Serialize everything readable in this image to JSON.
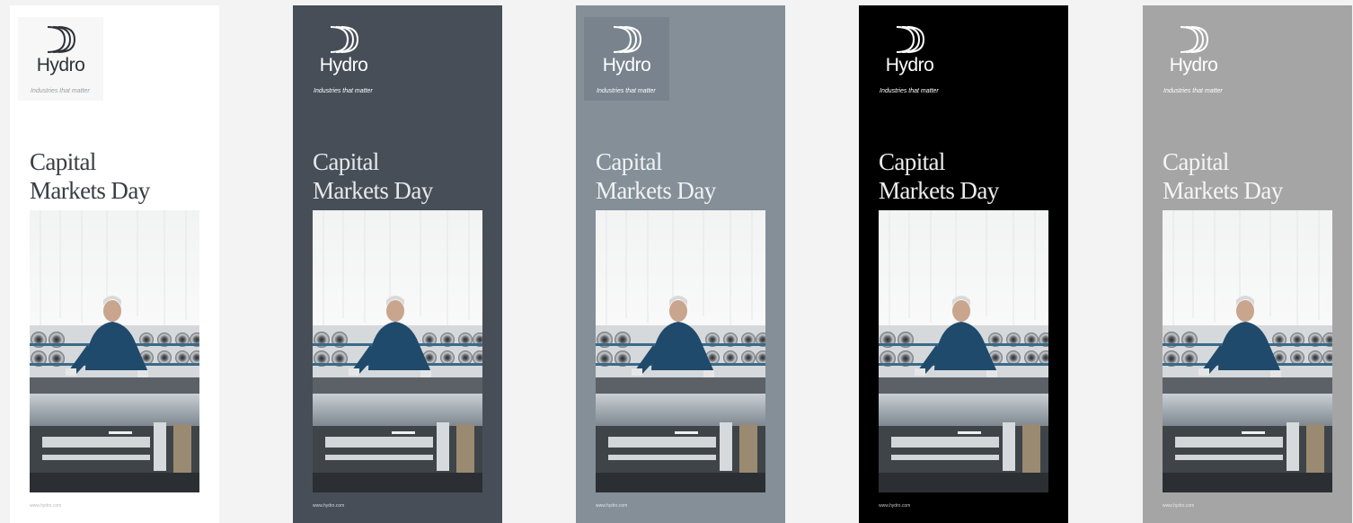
{
  "banners": [
    {
      "variant": "white",
      "logo_text": "Hydro",
      "tagline": "Industries that matter",
      "headline_line1": "Capital",
      "headline_line2": "Markets Day",
      "url": "www.hydro.com"
    },
    {
      "variant": "slate",
      "logo_text": "Hydro",
      "tagline": "Industries that matter",
      "headline_line1": "Capital",
      "headline_line2": "Markets Day",
      "url": "www.hydro.com"
    },
    {
      "variant": "steel",
      "logo_text": "Hydro",
      "tagline": "Industries that matter",
      "headline_line1": "Capital",
      "headline_line2": "Markets Day",
      "url": "www.hydro.com"
    },
    {
      "variant": "black",
      "logo_text": "Hydro",
      "tagline": "Industries that matter",
      "headline_line1": "Capital",
      "headline_line2": "Markets Day",
      "url": "www.hydro.com"
    },
    {
      "variant": "grey",
      "logo_text": "Hydro",
      "tagline": "Industries that matter",
      "headline_line1": "Capital",
      "headline_line2": "Markets Day",
      "url": "www.hydro.com"
    }
  ],
  "colors": {
    "white": "#ffffff",
    "slate": "#474e57",
    "steel": "#848f98",
    "black": "#000000",
    "grey": "#a5a5a5",
    "page_background": "#f3f3f3",
    "worker_shirt": "#1f4a6b"
  },
  "icons": {
    "logo": "hydro-ship-logo-icon",
    "photo": "factory-worker-photo"
  }
}
